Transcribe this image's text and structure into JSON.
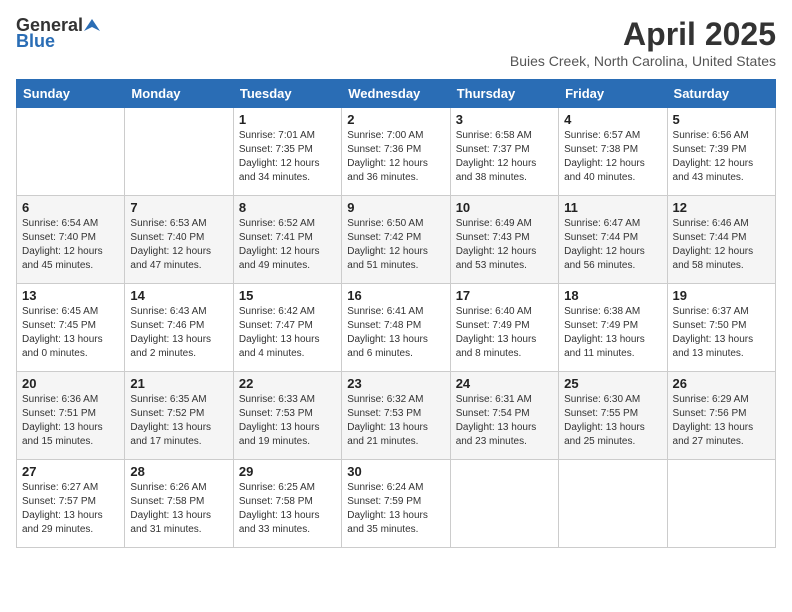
{
  "header": {
    "logo_general": "General",
    "logo_blue": "Blue",
    "title": "April 2025",
    "subtitle": "Buies Creek, North Carolina, United States"
  },
  "days_of_week": [
    "Sunday",
    "Monday",
    "Tuesday",
    "Wednesday",
    "Thursday",
    "Friday",
    "Saturday"
  ],
  "weeks": [
    [
      {
        "day": "",
        "info": ""
      },
      {
        "day": "",
        "info": ""
      },
      {
        "day": "1",
        "info": "Sunrise: 7:01 AM\nSunset: 7:35 PM\nDaylight: 12 hours and 34 minutes."
      },
      {
        "day": "2",
        "info": "Sunrise: 7:00 AM\nSunset: 7:36 PM\nDaylight: 12 hours and 36 minutes."
      },
      {
        "day": "3",
        "info": "Sunrise: 6:58 AM\nSunset: 7:37 PM\nDaylight: 12 hours and 38 minutes."
      },
      {
        "day": "4",
        "info": "Sunrise: 6:57 AM\nSunset: 7:38 PM\nDaylight: 12 hours and 40 minutes."
      },
      {
        "day": "5",
        "info": "Sunrise: 6:56 AM\nSunset: 7:39 PM\nDaylight: 12 hours and 43 minutes."
      }
    ],
    [
      {
        "day": "6",
        "info": "Sunrise: 6:54 AM\nSunset: 7:40 PM\nDaylight: 12 hours and 45 minutes."
      },
      {
        "day": "7",
        "info": "Sunrise: 6:53 AM\nSunset: 7:40 PM\nDaylight: 12 hours and 47 minutes."
      },
      {
        "day": "8",
        "info": "Sunrise: 6:52 AM\nSunset: 7:41 PM\nDaylight: 12 hours and 49 minutes."
      },
      {
        "day": "9",
        "info": "Sunrise: 6:50 AM\nSunset: 7:42 PM\nDaylight: 12 hours and 51 minutes."
      },
      {
        "day": "10",
        "info": "Sunrise: 6:49 AM\nSunset: 7:43 PM\nDaylight: 12 hours and 53 minutes."
      },
      {
        "day": "11",
        "info": "Sunrise: 6:47 AM\nSunset: 7:44 PM\nDaylight: 12 hours and 56 minutes."
      },
      {
        "day": "12",
        "info": "Sunrise: 6:46 AM\nSunset: 7:44 PM\nDaylight: 12 hours and 58 minutes."
      }
    ],
    [
      {
        "day": "13",
        "info": "Sunrise: 6:45 AM\nSunset: 7:45 PM\nDaylight: 13 hours and 0 minutes."
      },
      {
        "day": "14",
        "info": "Sunrise: 6:43 AM\nSunset: 7:46 PM\nDaylight: 13 hours and 2 minutes."
      },
      {
        "day": "15",
        "info": "Sunrise: 6:42 AM\nSunset: 7:47 PM\nDaylight: 13 hours and 4 minutes."
      },
      {
        "day": "16",
        "info": "Sunrise: 6:41 AM\nSunset: 7:48 PM\nDaylight: 13 hours and 6 minutes."
      },
      {
        "day": "17",
        "info": "Sunrise: 6:40 AM\nSunset: 7:49 PM\nDaylight: 13 hours and 8 minutes."
      },
      {
        "day": "18",
        "info": "Sunrise: 6:38 AM\nSunset: 7:49 PM\nDaylight: 13 hours and 11 minutes."
      },
      {
        "day": "19",
        "info": "Sunrise: 6:37 AM\nSunset: 7:50 PM\nDaylight: 13 hours and 13 minutes."
      }
    ],
    [
      {
        "day": "20",
        "info": "Sunrise: 6:36 AM\nSunset: 7:51 PM\nDaylight: 13 hours and 15 minutes."
      },
      {
        "day": "21",
        "info": "Sunrise: 6:35 AM\nSunset: 7:52 PM\nDaylight: 13 hours and 17 minutes."
      },
      {
        "day": "22",
        "info": "Sunrise: 6:33 AM\nSunset: 7:53 PM\nDaylight: 13 hours and 19 minutes."
      },
      {
        "day": "23",
        "info": "Sunrise: 6:32 AM\nSunset: 7:53 PM\nDaylight: 13 hours and 21 minutes."
      },
      {
        "day": "24",
        "info": "Sunrise: 6:31 AM\nSunset: 7:54 PM\nDaylight: 13 hours and 23 minutes."
      },
      {
        "day": "25",
        "info": "Sunrise: 6:30 AM\nSunset: 7:55 PM\nDaylight: 13 hours and 25 minutes."
      },
      {
        "day": "26",
        "info": "Sunrise: 6:29 AM\nSunset: 7:56 PM\nDaylight: 13 hours and 27 minutes."
      }
    ],
    [
      {
        "day": "27",
        "info": "Sunrise: 6:27 AM\nSunset: 7:57 PM\nDaylight: 13 hours and 29 minutes."
      },
      {
        "day": "28",
        "info": "Sunrise: 6:26 AM\nSunset: 7:58 PM\nDaylight: 13 hours and 31 minutes."
      },
      {
        "day": "29",
        "info": "Sunrise: 6:25 AM\nSunset: 7:58 PM\nDaylight: 13 hours and 33 minutes."
      },
      {
        "day": "30",
        "info": "Sunrise: 6:24 AM\nSunset: 7:59 PM\nDaylight: 13 hours and 35 minutes."
      },
      {
        "day": "",
        "info": ""
      },
      {
        "day": "",
        "info": ""
      },
      {
        "day": "",
        "info": ""
      }
    ]
  ]
}
